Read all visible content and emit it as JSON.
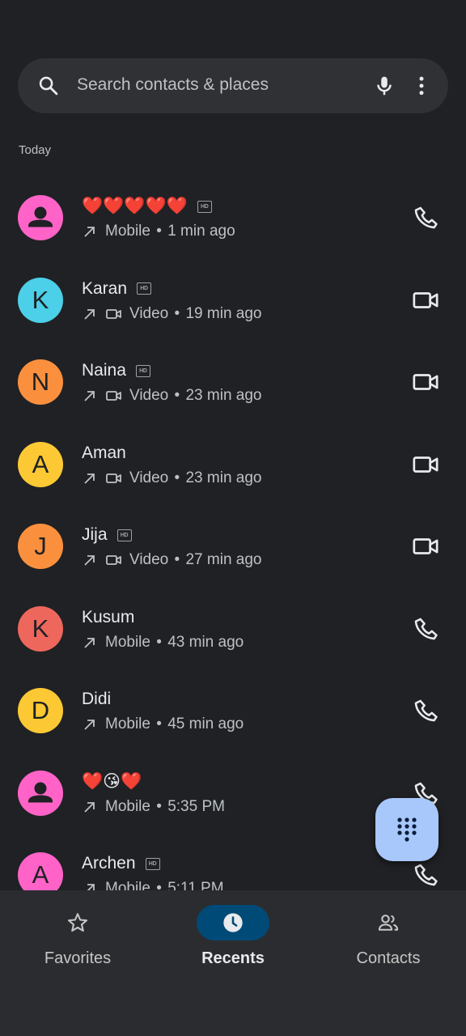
{
  "search": {
    "placeholder": "Search contacts & places"
  },
  "section_label": "Today",
  "calls": [
    {
      "name": "❤️❤️❤️❤️❤️",
      "hd": true,
      "initial": "",
      "avatar_color": "#ff63c8",
      "avatar_type": "person",
      "call_type": "Mobile",
      "time": "1 min ago",
      "action_icon": "phone-icon",
      "video": false
    },
    {
      "name": "Karan",
      "hd": true,
      "initial": "K",
      "avatar_color": "#4ccfe8",
      "avatar_type": "letter",
      "call_type": "Video",
      "time": "19 min ago",
      "action_icon": "video-camera-icon",
      "video": true
    },
    {
      "name": "Naina",
      "hd": true,
      "initial": "N",
      "avatar_color": "#fa903e",
      "avatar_type": "letter",
      "call_type": "Video",
      "time": "23 min ago",
      "action_icon": "video-camera-icon",
      "video": true
    },
    {
      "name": "Aman",
      "hd": false,
      "initial": "A",
      "avatar_color": "#fcc934",
      "avatar_type": "letter",
      "call_type": "Video",
      "time": "23 min ago",
      "action_icon": "video-camera-icon",
      "video": true
    },
    {
      "name": "Jija",
      "hd": true,
      "initial": "J",
      "avatar_color": "#fa903e",
      "avatar_type": "letter",
      "call_type": "Video",
      "time": "27 min ago",
      "action_icon": "video-camera-icon",
      "video": true
    },
    {
      "name": "Kusum",
      "hd": false,
      "initial": "K",
      "avatar_color": "#ee675c",
      "avatar_type": "letter",
      "call_type": "Mobile",
      "time": "43 min ago",
      "action_icon": "phone-icon",
      "video": false
    },
    {
      "name": "Didi",
      "hd": false,
      "initial": "D",
      "avatar_color": "#fcc934",
      "avatar_type": "letter",
      "call_type": "Mobile",
      "time": "45 min ago",
      "action_icon": "phone-icon",
      "video": false
    },
    {
      "name": "❤️😘❤️",
      "hd": false,
      "initial": "",
      "avatar_color": "#ff63c8",
      "avatar_type": "person",
      "call_type": "Mobile",
      "time": "5:35 PM",
      "action_icon": "phone-icon",
      "video": false
    },
    {
      "name": "Archen",
      "hd": true,
      "initial": "A",
      "avatar_color": "#ff63c8",
      "avatar_type": "letter",
      "call_type": "Mobile",
      "time": "5:11 PM",
      "action_icon": "phone-icon",
      "video": false
    }
  ],
  "separator": "•",
  "fab": {
    "icon": "dialpad-icon",
    "color": "#a8c7fa"
  },
  "nav": [
    {
      "label": "Favorites",
      "icon": "star-icon",
      "active": false
    },
    {
      "label": "Recents",
      "icon": "clock-icon",
      "active": true
    },
    {
      "label": "Contacts",
      "icon": "people-icon",
      "active": false
    }
  ],
  "colors": {
    "background": "#202124",
    "surface": "#303134",
    "nav_background": "#2b2c2f",
    "active_pill": "#004a77"
  }
}
